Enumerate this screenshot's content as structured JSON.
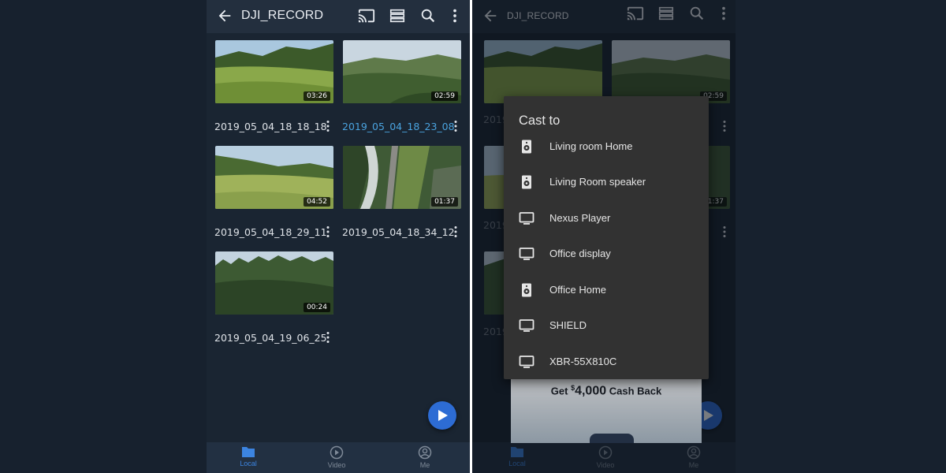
{
  "colors": {
    "background": "#17212e",
    "appbar": "#232f3e",
    "accent": "#3c84e0",
    "active_filename": "#4aa3df",
    "dialog": "#323232"
  },
  "appbar": {
    "title": "DJI_RECORD",
    "icons": [
      "arrow-back-icon",
      "cast-icon",
      "view-list-icon",
      "search-icon",
      "more-vert-icon"
    ]
  },
  "videos": [
    {
      "name": "2019_05_04_18_18_18",
      "duration": "03:26",
      "active": false
    },
    {
      "name": "2019_05_04_18_23_08",
      "duration": "02:59",
      "active": true
    },
    {
      "name": "2019_05_04_18_29_11",
      "duration": "04:52",
      "active": false
    },
    {
      "name": "2019_05_04_18_34_12",
      "duration": "01:37",
      "active": false
    },
    {
      "name": "2019_05_04_19_06_25",
      "duration": "00:24",
      "active": false
    }
  ],
  "bottom_nav": [
    {
      "label": "Local",
      "icon": "folder-icon",
      "active": true
    },
    {
      "label": "Video",
      "icon": "play-circle-icon",
      "active": false
    },
    {
      "label": "Me",
      "icon": "account-icon",
      "active": false
    }
  ],
  "cast_dialog": {
    "title": "Cast to",
    "devices": [
      {
        "label": "Living room Home",
        "icon": "speaker-icon"
      },
      {
        "label": "Living Room speaker",
        "icon": "speaker-icon"
      },
      {
        "label": "Nexus Player",
        "icon": "tv-icon"
      },
      {
        "label": "Office display",
        "icon": "tv-icon"
      },
      {
        "label": "Office Home",
        "icon": "speaker-icon"
      },
      {
        "label": "SHIELD",
        "icon": "tv-icon"
      },
      {
        "label": "XBR-55X810C",
        "icon": "tv-icon"
      }
    ]
  },
  "ad": {
    "prefix": "Get ",
    "currency": "$",
    "amount": "4,000",
    "suffix": " Cash Back"
  },
  "background_fragments": {
    "partial_name": "2019"
  }
}
